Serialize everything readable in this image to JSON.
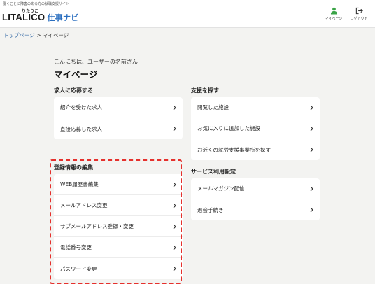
{
  "header": {
    "tagline": "働くことに障害のある方の就職支援サイト",
    "logo_kana": "りたりこ",
    "logo_main": "LITALICO",
    "logo_sub": "仕事ナビ",
    "mypage_label": "マイページ",
    "logout_label": "ログアウト"
  },
  "breadcrumb": {
    "home": "トップページ",
    "separator": " > ",
    "current": "マイページ"
  },
  "greeting": "こんにちは、ユーザーの名前さん",
  "page_title": "マイページ",
  "sections": {
    "apply": {
      "title": "求人に応募する",
      "items": [
        "紹介を受けた求人",
        "直接応募した求人"
      ]
    },
    "profile": {
      "title": "登録情報の編集",
      "items": [
        "WEB履歴書編集",
        "メールアドレス変更",
        "サブメールアドレス登録・変更",
        "電話番号変更",
        "パスワード変更"
      ]
    },
    "support": {
      "title": "支援を探す",
      "items": [
        "閲覧した施設",
        "お気に入りに追加した施設",
        "お近くの就労支援事業所を探す"
      ]
    },
    "service": {
      "title": "サービス利用設定",
      "items": [
        "メールマガジン配信",
        "退会手続き"
      ]
    }
  },
  "colors": {
    "accent": "#2b6fc0",
    "icon_green": "#3aa346",
    "highlight": "#e5302c",
    "background": "#f3f3f1"
  },
  "icons": {
    "mypage": "person-icon",
    "logout": "logout-icon",
    "row": "chevron-right-icon"
  }
}
